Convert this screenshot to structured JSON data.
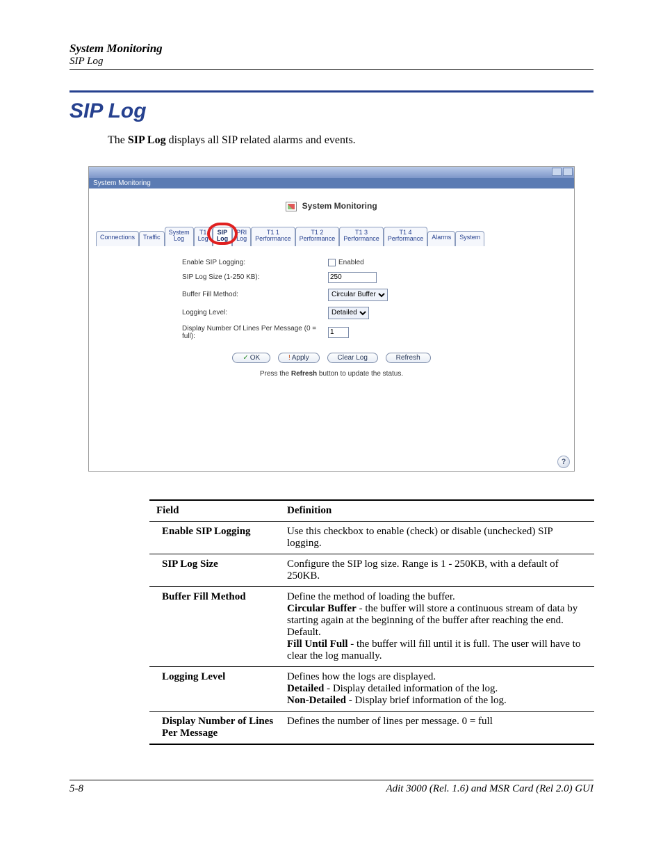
{
  "header": {
    "chapter": "System Monitoring",
    "section": "SIP Log"
  },
  "title": "SIP Log",
  "intro_prefix": "The ",
  "intro_bold": "SIP Log",
  "intro_suffix": " displays all SIP related alarms and events.",
  "screenshot": {
    "crumb": "System Monitoring",
    "page_title": "System Monitoring",
    "tabs": [
      "Connections",
      "Traffic",
      "System\nLog",
      "T1\nLog",
      "SIP\nLog",
      "PRI\nLog",
      "T1 1\nPerformance",
      "T1 2\nPerformance",
      "T1 3\nPerformance",
      "T1 4\nPerformance",
      "Alarms",
      "System"
    ],
    "active_tab_index": 4,
    "fields": {
      "enable_label": "Enable SIP Logging:",
      "enable_text": "Enabled",
      "size_label": "SIP Log Size (1-250 KB):",
      "size_value": "250",
      "buffer_label": "Buffer Fill Method:",
      "buffer_value": "Circular Buffer",
      "level_label": "Logging Level:",
      "level_value": "Detailed",
      "lines_label": "Display Number Of Lines Per Message (0 = full):",
      "lines_value": "1"
    },
    "buttons": {
      "ok": "OK",
      "apply": "Apply",
      "clear": "Clear Log",
      "refresh": "Refresh"
    },
    "hint_prefix": "Press the ",
    "hint_bold": "Refresh",
    "hint_suffix": " button to update the status."
  },
  "table": {
    "head_field": "Field",
    "head_def": "Definition",
    "rows": [
      {
        "field": "Enable SIP Logging",
        "def_html": "Use this checkbox to enable (check) or disable (unchecked) SIP logging."
      },
      {
        "field": "SIP Log Size",
        "def_html": "Configure the SIP log size. Range is 1 - 250KB, with a default of 250KB."
      },
      {
        "field": "Buffer Fill Method",
        "def_html": "Define the method of loading the buffer.<br><b>Circular Buffer</b> - the buffer will store a continuous stream of data by starting again at the beginning of the buffer after reaching the end. Default.<br><b>Fill Until Full</b> - the buffer will fill until it is full. The user will have to clear the log manually."
      },
      {
        "field": "Logging Level",
        "def_html": "Defines how the logs are displayed.<br><b>Detailed</b> - Display detailed information of the log.<br><b>Non-Detailed</b> - Display brief information of the log."
      },
      {
        "field": "Display Number of Lines Per Message",
        "def_html": "Defines the number of lines per message. 0 = full"
      }
    ]
  },
  "footer": {
    "page": "5-8",
    "doc": "Adit 3000 (Rel. 1.6) and MSR Card (Rel 2.0) GUI"
  }
}
